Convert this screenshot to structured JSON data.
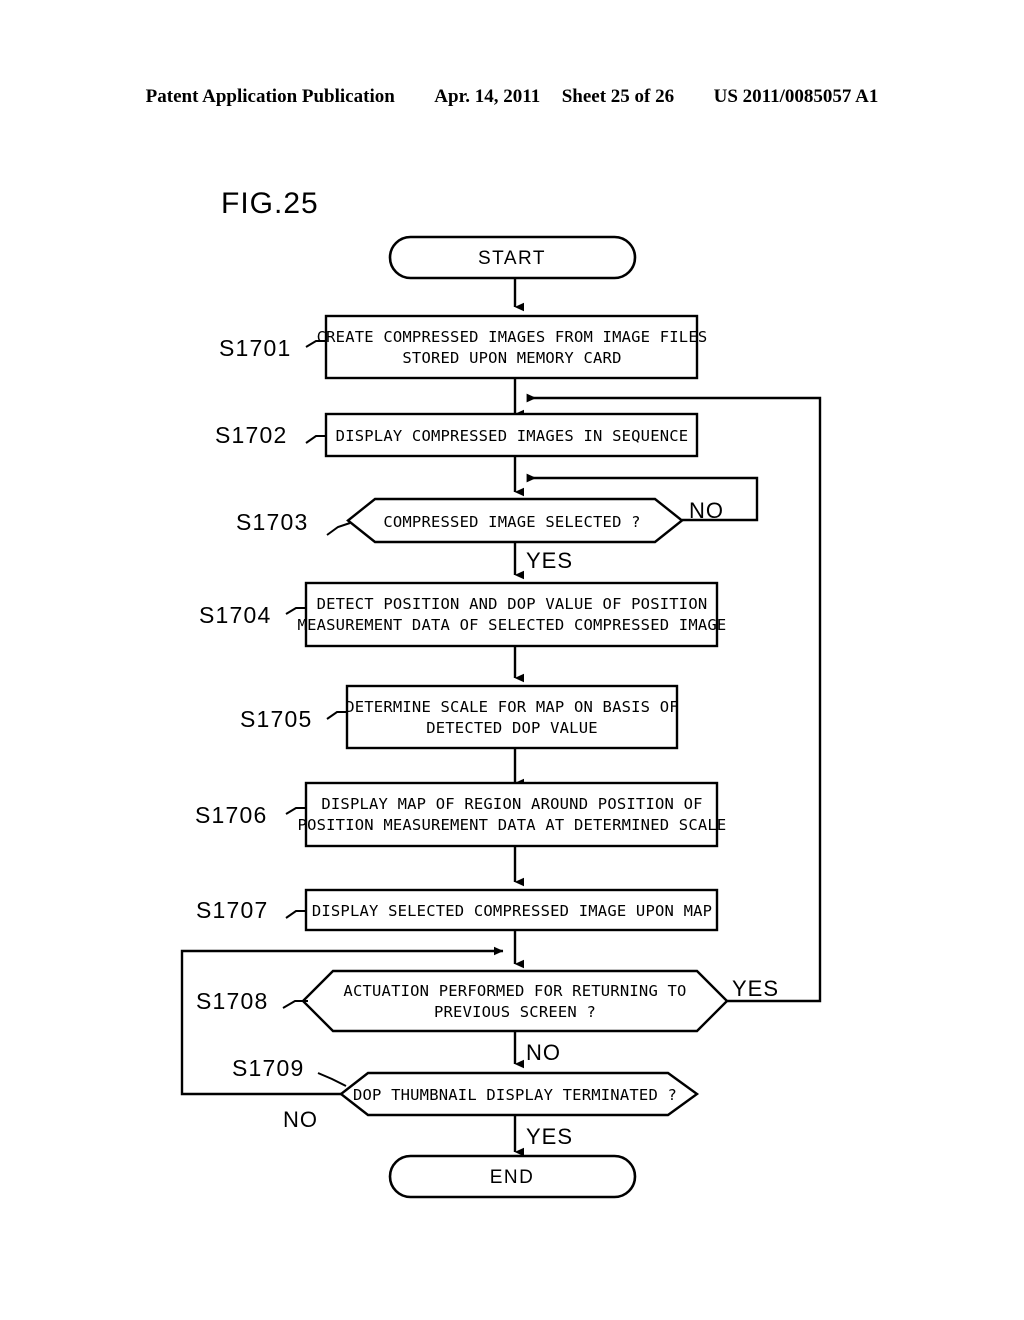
{
  "header": {
    "publication": "Patent Application Publication",
    "date": "Apr. 14, 2011",
    "sheet": "Sheet 25 of 26",
    "patent_number": "US 2011/0085057 A1"
  },
  "figure": {
    "title": "FIG.25"
  },
  "flow": {
    "start": {
      "label": "START"
    },
    "end": {
      "label": "END"
    },
    "steps": [
      {
        "id": "S1701",
        "shape": "process",
        "lines": [
          "CREATE COMPRESSED IMAGES FROM IMAGE FILES",
          "STORED UPON MEMORY CARD"
        ]
      },
      {
        "id": "S1702",
        "shape": "process",
        "lines": [
          "DISPLAY COMPRESSED IMAGES IN SEQUENCE"
        ]
      },
      {
        "id": "S1703",
        "shape": "decision",
        "lines": [
          "COMPRESSED IMAGE SELECTED ?"
        ],
        "yes_label": "YES",
        "no_label": "NO"
      },
      {
        "id": "S1704",
        "shape": "process",
        "lines": [
          "DETECT POSITION AND DOP VALUE OF POSITION",
          "MEASUREMENT DATA OF SELECTED COMPRESSED IMAGE"
        ]
      },
      {
        "id": "S1705",
        "shape": "process",
        "lines": [
          "DETERMINE SCALE FOR MAP ON BASIS OF",
          "DETECTED DOP VALUE"
        ]
      },
      {
        "id": "S1706",
        "shape": "process",
        "lines": [
          "DISPLAY MAP OF REGION AROUND POSITION OF",
          "POSITION MEASUREMENT DATA AT DETERMINED SCALE"
        ]
      },
      {
        "id": "S1707",
        "shape": "process",
        "lines": [
          "DISPLAY SELECTED COMPRESSED IMAGE UPON MAP"
        ]
      },
      {
        "id": "S1708",
        "shape": "decision",
        "lines": [
          "ACTUATION PERFORMED FOR RETURNING TO",
          "PREVIOUS SCREEN ?"
        ],
        "yes_label": "YES",
        "no_label": "NO"
      },
      {
        "id": "S1709",
        "shape": "decision",
        "lines": [
          "DOP THUMBNAIL DISPLAY TERMINATED ?"
        ],
        "yes_label": "YES",
        "no_label": "NO"
      }
    ]
  },
  "colors": {
    "ink": "#000000",
    "paper": "#ffffff"
  }
}
